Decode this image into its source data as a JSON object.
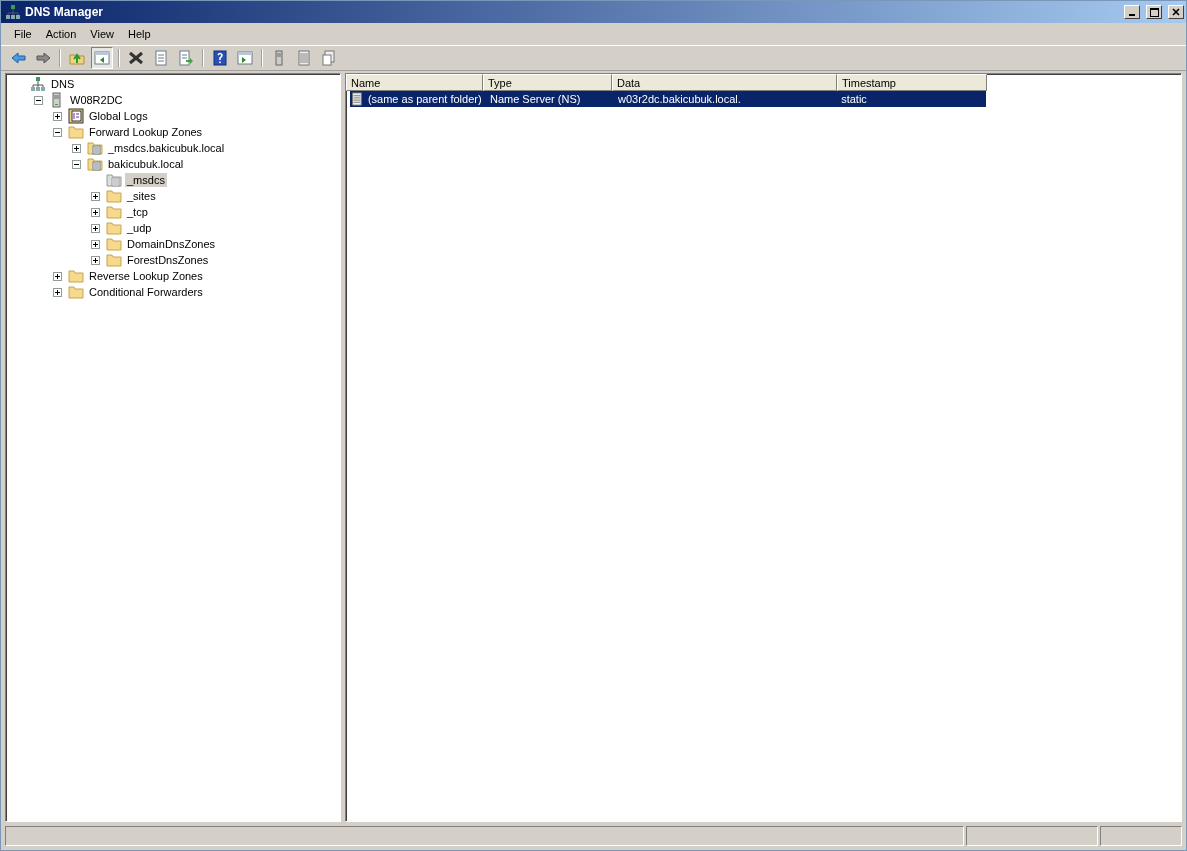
{
  "window": {
    "title": "DNS Manager"
  },
  "menu": [
    "File",
    "Action",
    "View",
    "Help"
  ],
  "toolbar": [
    {
      "kind": "back",
      "pressed": false
    },
    {
      "kind": "forward",
      "pressed": false
    },
    {
      "kind": "sep"
    },
    {
      "kind": "up",
      "pressed": false
    },
    {
      "kind": "tree",
      "pressed": true
    },
    {
      "kind": "sep"
    },
    {
      "kind": "delete",
      "pressed": false
    },
    {
      "kind": "properties",
      "pressed": false
    },
    {
      "kind": "export",
      "pressed": false
    },
    {
      "kind": "sep"
    },
    {
      "kind": "help",
      "pressed": false
    },
    {
      "kind": "actionpane",
      "pressed": false
    },
    {
      "kind": "sep"
    },
    {
      "kind": "server",
      "pressed": false
    },
    {
      "kind": "records",
      "pressed": false
    },
    {
      "kind": "copy",
      "pressed": false
    }
  ],
  "tree": [
    {
      "label": "DNS",
      "kind": "dns",
      "selected": false,
      "children": [
        {
          "label": "W08R2DC",
          "kind": "server",
          "expanded": true,
          "selected": false,
          "children": [
            {
              "label": "Global Logs",
              "kind": "logs",
              "expanded": false,
              "selected": false
            },
            {
              "label": "Forward Lookup Zones",
              "kind": "folder",
              "expanded": true,
              "selected": false,
              "children": [
                {
                  "label": "_msdcs.bakicubuk.local",
                  "kind": "zone",
                  "expanded": false,
                  "selected": false
                },
                {
                  "label": "bakicubuk.local",
                  "kind": "zone",
                  "expanded": true,
                  "selected": false,
                  "children": [
                    {
                      "label": "_msdcs",
                      "kind": "delegation",
                      "selected": true
                    },
                    {
                      "label": "_sites",
                      "kind": "folder",
                      "expanded": false,
                      "selected": false
                    },
                    {
                      "label": "_tcp",
                      "kind": "folder",
                      "expanded": false,
                      "selected": false
                    },
                    {
                      "label": "_udp",
                      "kind": "folder",
                      "expanded": false,
                      "selected": false
                    },
                    {
                      "label": "DomainDnsZones",
                      "kind": "folder",
                      "expanded": false,
                      "selected": false
                    },
                    {
                      "label": "ForestDnsZones",
                      "kind": "folder",
                      "expanded": false,
                      "selected": false
                    }
                  ]
                }
              ]
            },
            {
              "label": "Reverse Lookup Zones",
              "kind": "folder",
              "expanded": false,
              "selected": false
            },
            {
              "label": "Conditional Forwarders",
              "kind": "folder",
              "expanded": false,
              "selected": false
            }
          ]
        }
      ]
    }
  ],
  "list": {
    "columns": [
      "Name",
      "Type",
      "Data",
      "Timestamp"
    ],
    "rows": [
      {
        "cells": [
          "(same as parent folder)",
          "Name Server (NS)",
          "w03r2dc.bakicubuk.local.",
          "static"
        ],
        "selected": true
      }
    ]
  }
}
